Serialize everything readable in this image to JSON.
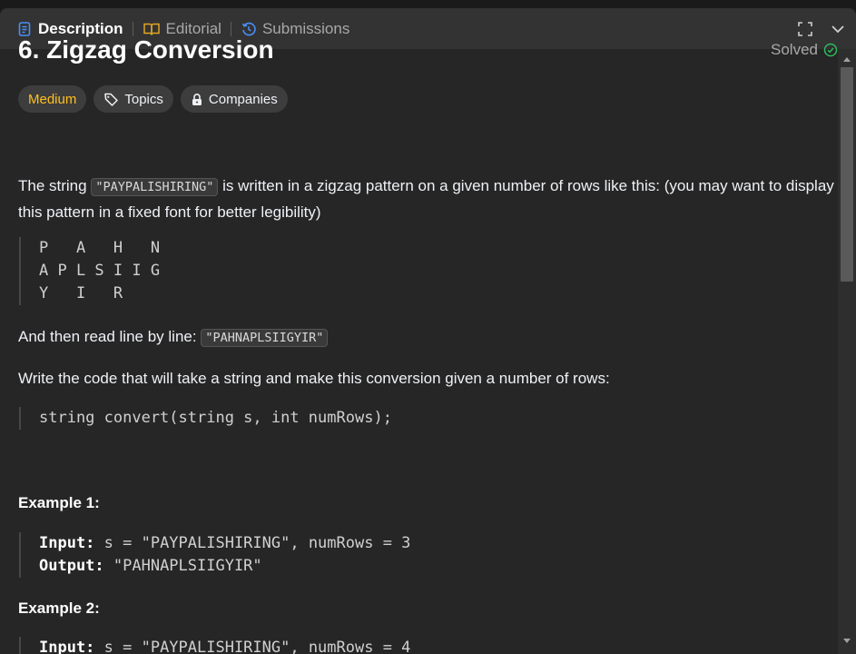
{
  "tabs": [
    {
      "label": "Description",
      "icon": "description-icon",
      "active": true,
      "color": "#4a8ff7"
    },
    {
      "label": "Editorial",
      "icon": "book-icon",
      "active": false,
      "color": "#e0a526"
    },
    {
      "label": "Submissions",
      "icon": "history-icon",
      "active": false,
      "color": "#4a8ff7"
    }
  ],
  "problem": {
    "title": "6. Zigzag Conversion",
    "status": "Solved",
    "status_color": "#2cbb5d",
    "difficulty": "Medium",
    "difficulty_color": "#ffc01e",
    "topics_label": "Topics",
    "companies_label": "Companies"
  },
  "description": {
    "p1_before": "The string ",
    "p1_code": "\"PAYPALISHIRING\"",
    "p1_after": " is written in a zigzag pattern on a given number of rows like this: (you may want to display this pattern in a fixed font for better legibility)",
    "pattern": "P   A   H   N\nA P L S I I G\nY   I   R",
    "p2_before": "And then read line by line: ",
    "p2_code": "\"PAHNAPLSIIGYIR\"",
    "p3": "Write the code that will take a string and make this conversion given a number of rows:",
    "signature": "string convert(string s, int numRows);"
  },
  "examples": [
    {
      "heading": "Example 1:",
      "input_label": "Input:",
      "input_value": " s = \"PAYPALISHIRING\", numRows = 3",
      "output_label": "Output:",
      "output_value": " \"PAHNAPLSIIGYIR\""
    },
    {
      "heading": "Example 2:",
      "input_label": "Input:",
      "input_value": " s = \"PAYPALISHIRING\", numRows = 4"
    }
  ]
}
